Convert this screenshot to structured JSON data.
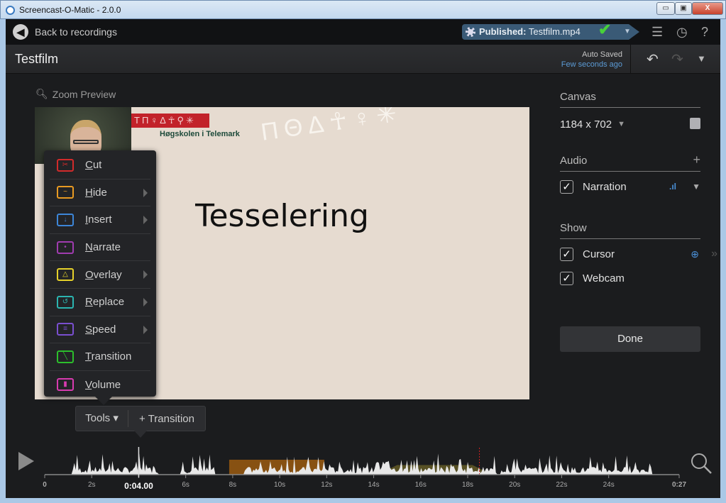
{
  "window": {
    "title": "Screencast-O-Matic - 2.0.0",
    "minimize": "▭",
    "maximize": "▣",
    "close": "X"
  },
  "topbar": {
    "back_label": "Back to recordings",
    "published_label": "Published:",
    "published_file": "Testfilm.mp4",
    "icons": [
      "film-reel-icon",
      "checkmark-icon",
      "chevron-down-icon",
      "tasks-icon",
      "history-icon",
      "help-icon"
    ]
  },
  "header": {
    "title": "Testfilm",
    "auto_saved": "Auto Saved",
    "saved_time": "Few seconds ago"
  },
  "preview": {
    "zoom_label": "Zoom Preview",
    "slide_title": "Tesselering",
    "logo_text": "Høgskolen i Telemark"
  },
  "tools_menu": {
    "items": [
      {
        "label": "Cut",
        "key": "C",
        "rest": "ut",
        "color": "#d22b2b",
        "glyph": "✂",
        "submenu": false
      },
      {
        "label": "Hide",
        "key": "H",
        "rest": "ide",
        "color": "#e89a22",
        "glyph": "~",
        "submenu": true
      },
      {
        "label": "Insert",
        "key": "I",
        "rest": "nsert",
        "color": "#3d86d8",
        "glyph": "↓",
        "submenu": true
      },
      {
        "label": "Narrate",
        "key": "N",
        "rest": "arrate",
        "color": "#a03cb0",
        "glyph": "•",
        "submenu": false
      },
      {
        "label": "Overlay",
        "key": "O",
        "rest": "verlay",
        "color": "#e6d12a",
        "glyph": "△",
        "submenu": true
      },
      {
        "label": "Replace",
        "key": "R",
        "rest": "eplace",
        "color": "#2bb5b0",
        "glyph": "↺",
        "submenu": true
      },
      {
        "label": "Speed",
        "key": "S",
        "rest": "peed",
        "color": "#7a4fd0",
        "glyph": "≡",
        "submenu": true
      },
      {
        "label": "Transition",
        "key": "T",
        "rest": "ransition",
        "color": "#2cbf2c",
        "glyph": "╲",
        "submenu": false
      },
      {
        "label": "Volume",
        "key": "V",
        "rest": "olume",
        "color": "#d83bb0",
        "glyph": "▮",
        "submenu": false
      }
    ]
  },
  "tools_bar": {
    "tools_label": "Tools ▾",
    "transition_label": "+ Transition"
  },
  "sidebar": {
    "canvas": {
      "heading": "Canvas",
      "size": "1184 x 702"
    },
    "audio": {
      "heading": "Audio",
      "add": "+",
      "items": [
        {
          "label": "Narration",
          "checked": true
        }
      ]
    },
    "show": {
      "heading": "Show",
      "items": [
        {
          "label": "Cursor",
          "checked": true
        },
        {
          "label": "Webcam",
          "checked": true
        }
      ]
    },
    "done_label": "Done"
  },
  "timeline": {
    "duration_s": 27,
    "playhead_s": 4,
    "playhead_label": "0:04.00",
    "ticks": [
      "0",
      "2s",
      "4s",
      "6s",
      "8s",
      "10s",
      "12s",
      "14s",
      "16s",
      "18s",
      "20s",
      "22s",
      "24s",
      "0:27"
    ],
    "hide_segment_s": [
      7.85,
      11.9
    ],
    "hide_color": "#9a5a10",
    "overlay_segment_s": [
      14.2,
      19.0
    ],
    "overlay_color": "#c8b030",
    "marker_s": 18.5,
    "marker_color": "#d02020"
  }
}
